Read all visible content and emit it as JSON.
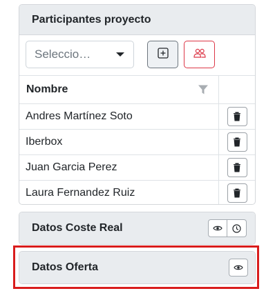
{
  "participants_card": {
    "title": "Participantes proyecto",
    "select_value": "Seleccio…",
    "add_button_icon": "plus-square-icon",
    "people_button_icon": "people-icon",
    "table": {
      "header_name": "Nombre",
      "rows": [
        {
          "name": "Andres Martínez Soto"
        },
        {
          "name": "Iberbox"
        },
        {
          "name": "Juan Garcia Perez"
        },
        {
          "name": "Laura Fernandez Ruiz"
        }
      ]
    }
  },
  "coste_card": {
    "title": "Datos Coste Real"
  },
  "oferta_card": {
    "title": "Datos Oferta"
  },
  "colors": {
    "accent_danger": "#dc3545",
    "header_bg": "#e9ecef",
    "highlight": "#d91c1c"
  }
}
